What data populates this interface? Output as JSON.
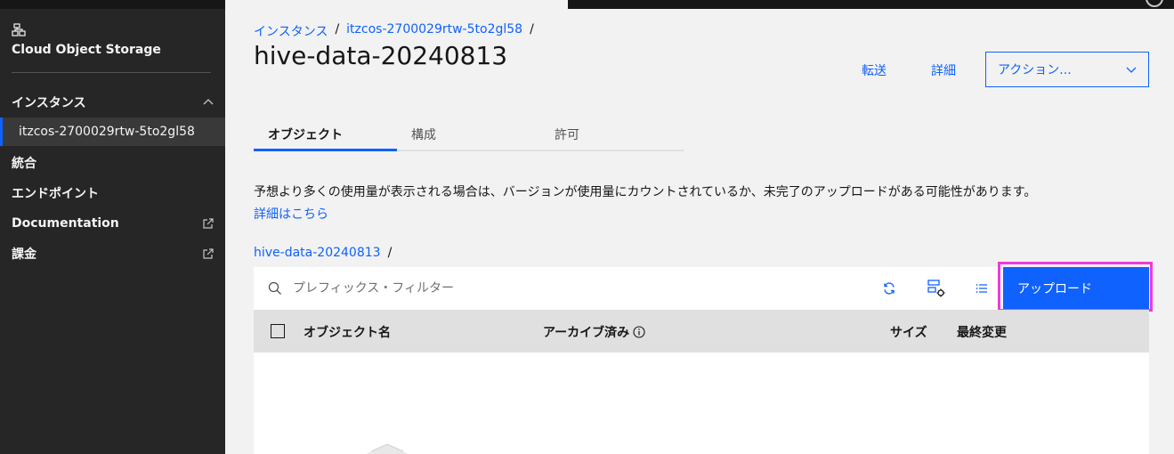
{
  "sidebar": {
    "service_title": "Cloud Object Storage",
    "items": [
      {
        "label": "インスタンス"
      },
      {
        "label": "統合"
      },
      {
        "label": "エンドポイント"
      },
      {
        "label": "Documentation"
      },
      {
        "label": "課金"
      }
    ],
    "selected_instance": "itzcos-2700029rtw-5to2gl58"
  },
  "breadcrumb": {
    "items": [
      "インスタンス",
      "itzcos-2700029rtw-5to2gl58"
    ],
    "separator": "/"
  },
  "page": {
    "title": "hive-data-20240813"
  },
  "header_actions": {
    "transfer": "転送",
    "details": "詳細",
    "actions": "アクション..."
  },
  "tabs": [
    {
      "label": "オブジェクト",
      "active": true
    },
    {
      "label": "構成",
      "active": false
    },
    {
      "label": "許可",
      "active": false
    }
  ],
  "notice": {
    "text": "予想より多くの使用量が表示される場合は、バージョンが使用量にカウントされているか、未完了のアップロードがある可能性があります。",
    "link": "詳細はこちら"
  },
  "path": {
    "bucket": "hive-data-20240813",
    "separator": "/"
  },
  "toolbar": {
    "search_placeholder": "プレフィックス・フィルター",
    "upload_label": "アップロード"
  },
  "table": {
    "columns": [
      "オブジェクト名",
      "アーカイブ済み",
      "サイズ",
      "最終変更"
    ]
  },
  "colors": {
    "primary": "#0f62fe",
    "sidebar_bg": "#262626",
    "highlight": "#ee3ad8"
  }
}
